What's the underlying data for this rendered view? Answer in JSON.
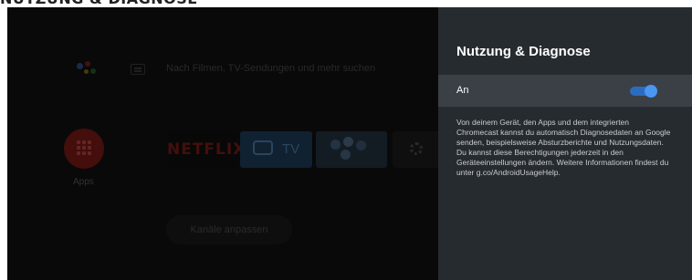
{
  "page_heading_cropped": "NUTZUNG & DIAGNOSE",
  "search": {
    "placeholder_text": "Nach Filmen, TV-Sendungen und mehr suchen"
  },
  "apps": {
    "label": "Apps"
  },
  "channel_row": {
    "tiles": [
      {
        "name": "NETFLIX"
      },
      {
        "name": "TV"
      }
    ]
  },
  "customize_channels_button": "Kanäle anpassen",
  "settings_panel": {
    "title": "Nutzung & Diagnose",
    "toggle_label": "An",
    "toggle_state": "on",
    "description": "Von deinem Gerät, den Apps und dem integrierten Chromecast kannst du automatisch Diagnosedaten an Google senden, beispielsweise Absturzberichte und Nutzungsdaten. Du kannst diese Berechtigungen jederzeit in den Geräteeinstellungen ändern. Weitere Informationen findest du unter g.co/AndroidUsageHelp."
  },
  "colors": {
    "panel_bg": "#262b30",
    "selected_row": "#3a4046",
    "toggle_accent": "#4a97f2",
    "apps_red": "#7a1b17",
    "netflix_red": "#7b1d18"
  },
  "icons": [
    "google-assistant-icon",
    "keyboard-icon",
    "apps-grid-icon",
    "tv-icon",
    "photos-icon",
    "gear-icon"
  ]
}
